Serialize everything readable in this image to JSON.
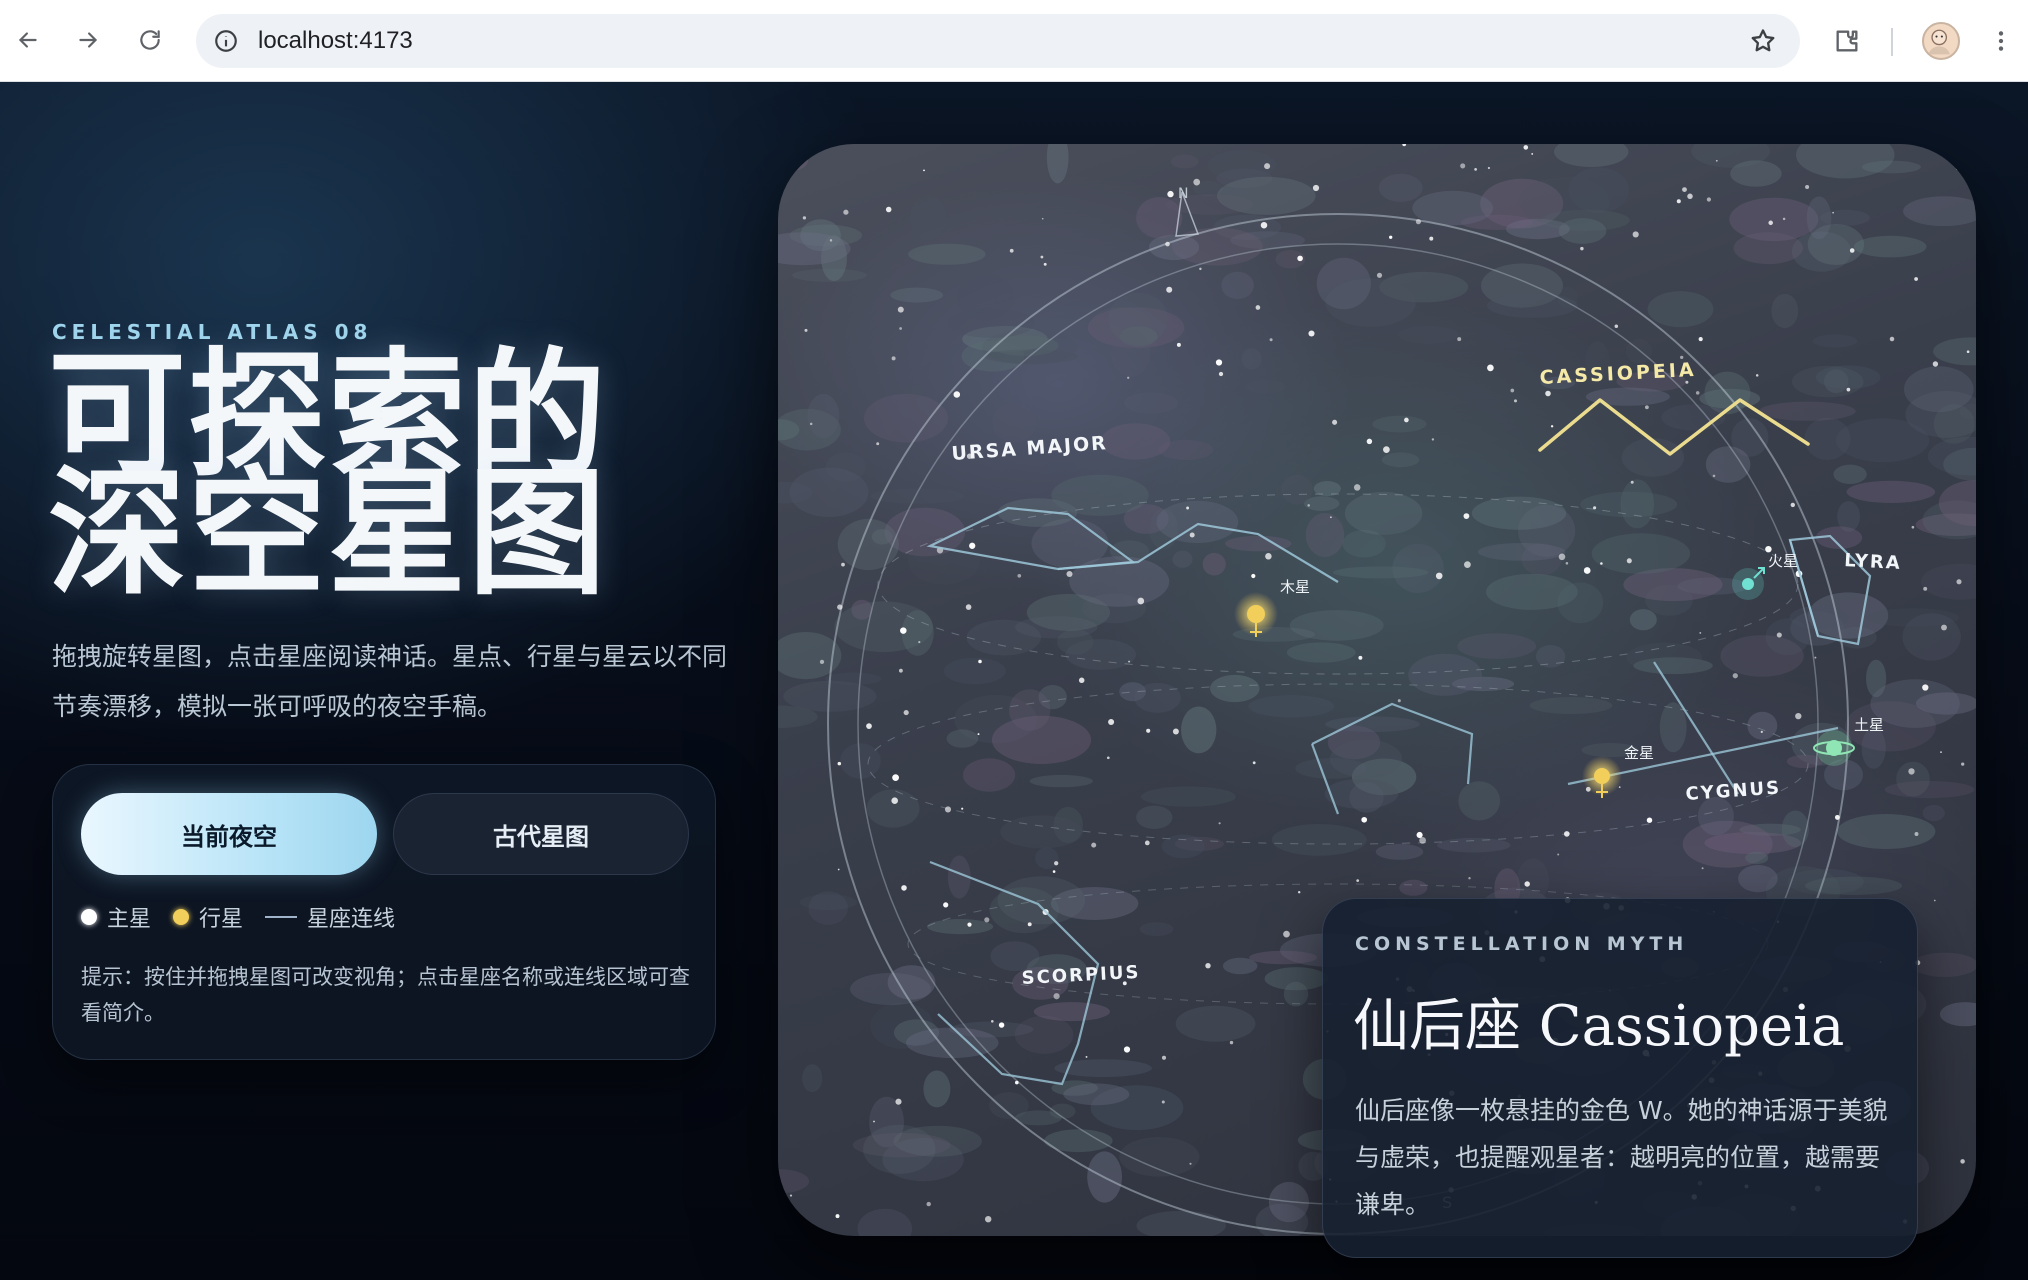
{
  "browser": {
    "url": "localhost:4173",
    "icons": [
      "back-icon",
      "forward-icon",
      "reload-icon",
      "info-icon",
      "star-icon",
      "extensions-icon",
      "profile-avatar",
      "more-menu-icon"
    ]
  },
  "hero": {
    "eyebrow": "CELESTIAL ATLAS 08",
    "title_line1": "可探索的",
    "title_line2": "深空星图",
    "lead": "拖拽旋转星图，点击星座阅读神话。星点、行星与星云以不同节奏漂移，模拟一张可呼吸的夜空手稿。"
  },
  "controls": {
    "mode_now": "当前夜空",
    "mode_ancient": "古代星图",
    "active_mode": "当前夜空",
    "legend": {
      "main_star": "主星",
      "planet": "行星",
      "constellation_line": "星座连线"
    },
    "hint": "提示：按住并拖拽星图可改变视角；点击星座名称或连线区域可查看简介。"
  },
  "sky": {
    "compass": {
      "north": "N",
      "south": "S"
    },
    "constellations": [
      "URSA MAJOR",
      "CASSIOPEIA",
      "LYRA",
      "CYGNUS",
      "SCORPIUS"
    ],
    "planets": [
      "木星",
      "火星",
      "金星",
      "土星"
    ]
  },
  "myth": {
    "eyebrow": "CONSTELLATION MYTH",
    "title": "仙后座 Cassiopeia",
    "body": "仙后座像一枚悬挂的金色 W。她的神话源于美貌与虚荣，也提醒观星者：越明亮的位置，越需要谦卑。"
  },
  "colors": {
    "accent": "#9fd4ec",
    "planet": "#f2cf5a",
    "cassiopeia_line": "#e8d98a",
    "constellation_line": "#8fb8cc"
  }
}
